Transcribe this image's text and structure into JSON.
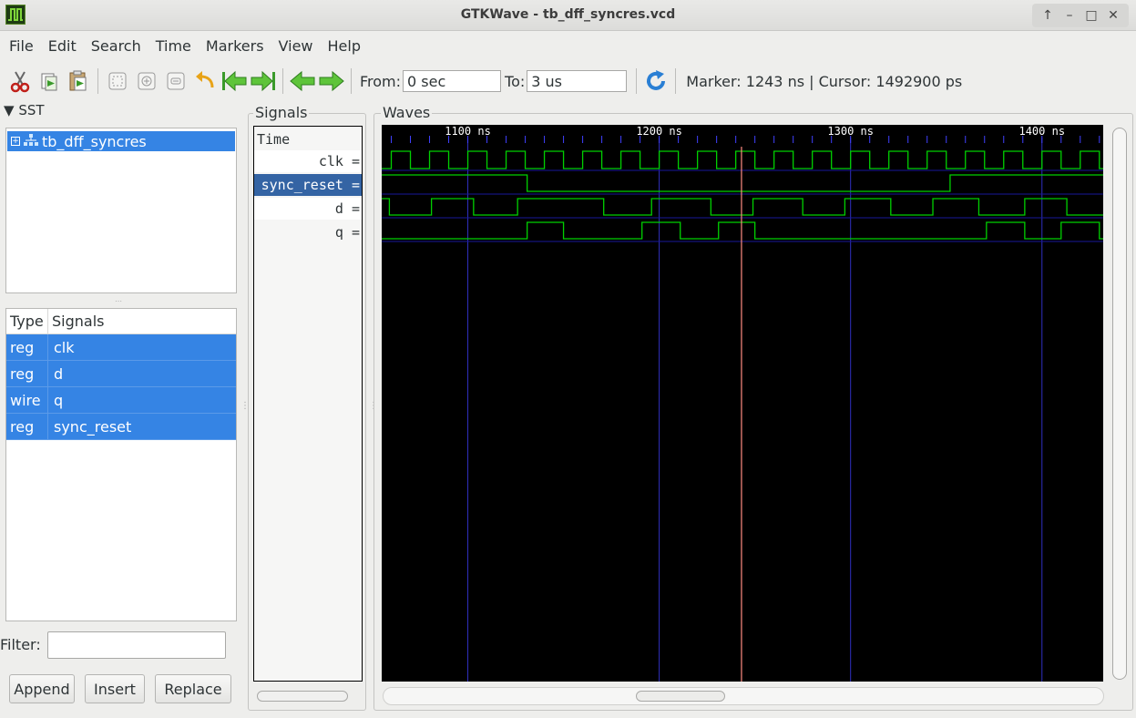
{
  "window": {
    "title": "GTKWave - tb_dff_syncres.vcd"
  },
  "menu": [
    "File",
    "Edit",
    "Search",
    "Time",
    "Markers",
    "View",
    "Help"
  ],
  "toolbar": {
    "from_label": "From:",
    "from_value": "0 sec",
    "to_label": "To:",
    "to_value": "3 us",
    "marker_text": "Marker: 1243 ns  |  Cursor: 1492900 ps"
  },
  "sst": {
    "header": "SST",
    "tree_item": "tb_dff_syncres",
    "columns": [
      "Type",
      "Signals"
    ],
    "rows": [
      {
        "type": "reg",
        "name": "clk"
      },
      {
        "type": "reg",
        "name": "d"
      },
      {
        "type": "wire",
        "name": "q"
      },
      {
        "type": "reg",
        "name": "sync_reset"
      }
    ],
    "filter_label": "Filter:",
    "filter_value": "",
    "buttons": {
      "append": "Append",
      "insert": "Insert",
      "replace": "Replace"
    }
  },
  "signals_pane": {
    "title": "Signals",
    "time_label": "Time",
    "signals": [
      "clk =",
      "sync_reset =",
      "d =",
      "q ="
    ],
    "selected": "sync_reset ="
  },
  "waves": {
    "title": "Waves",
    "view_start_ns": 1055,
    "view_end_ns": 1432,
    "time_labels": [
      {
        "t": 1100,
        "text": "1100 ns"
      },
      {
        "t": 1200,
        "text": "1200 ns"
      },
      {
        "t": 1300,
        "text": "1300 ns"
      },
      {
        "t": 1400,
        "text": "1400 ns"
      }
    ],
    "marker_ns": 1243,
    "colors": {
      "wave": "#00d000",
      "grid": "#3030c0",
      "marker": "#ff8c82",
      "background": "#000000",
      "ticks": "#4040ff"
    },
    "clk": {
      "first_rise_ns": 1060,
      "half_period_ns": 10,
      "initial": 0
    },
    "traces": [
      {
        "name": "sync_reset",
        "initial": 1,
        "edges": [
          1131,
          1352
        ]
      },
      {
        "name": "d",
        "initial": 1,
        "edges": [
          1059,
          1081,
          1103,
          1126,
          1171,
          1196,
          1227,
          1249,
          1275,
          1297,
          1321,
          1343,
          1367,
          1391,
          1413
        ]
      },
      {
        "name": "q",
        "initial": 0,
        "edges": [
          1131,
          1150,
          1191,
          1211,
          1231,
          1250,
          1371,
          1391,
          1410,
          1430
        ]
      }
    ]
  }
}
